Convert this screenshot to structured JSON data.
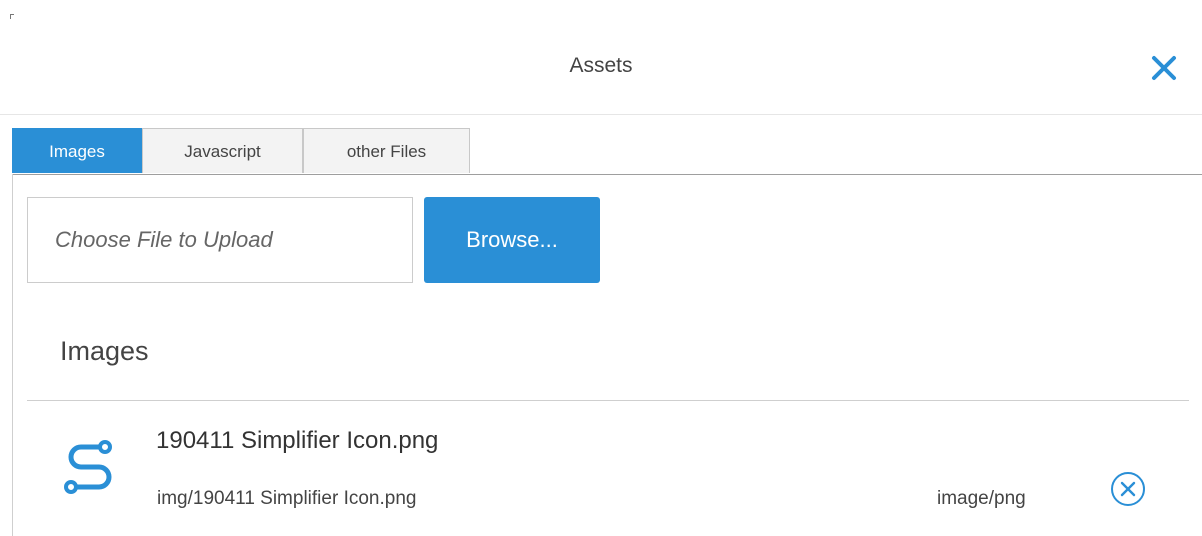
{
  "dialog": {
    "title": "Assets",
    "close_icon": "close-x-icon",
    "accent_color": "#2a8fd6"
  },
  "tabs": [
    {
      "label": "Images",
      "active": true
    },
    {
      "label": "Javascript",
      "active": false
    },
    {
      "label": "other Files",
      "active": false
    }
  ],
  "upload": {
    "placeholder": "Choose File to Upload",
    "browse_label": "Browse..."
  },
  "section": {
    "title": "Images"
  },
  "assets": [
    {
      "name": "190411 Simplifier Icon.png",
      "path": "img/190411 Simplifier Icon.png",
      "type": "image/png",
      "icon": "simplifier-logo-icon",
      "remove_icon": "circle-x-icon"
    }
  ]
}
